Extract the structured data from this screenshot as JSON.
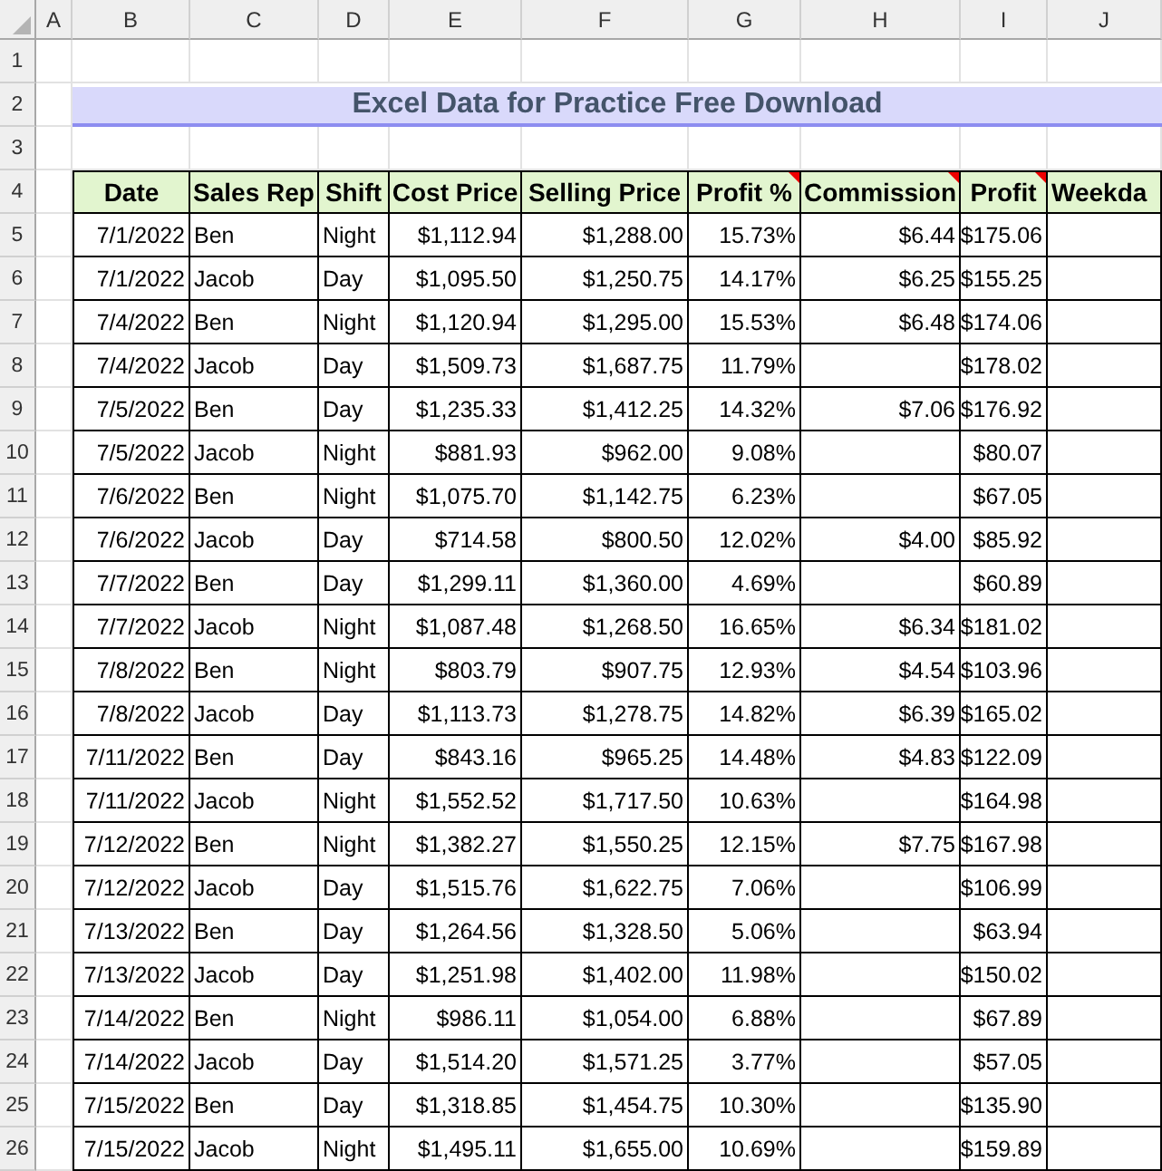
{
  "sheet": {
    "column_letters": [
      "A",
      "B",
      "C",
      "D",
      "E",
      "F",
      "G",
      "H",
      "I",
      "J"
    ],
    "row_numbers": [
      "1",
      "2",
      "3",
      "4",
      "5",
      "6",
      "7",
      "8",
      "9",
      "10",
      "11",
      "12",
      "13",
      "14",
      "15",
      "16",
      "17",
      "18",
      "19",
      "20",
      "21",
      "22",
      "23",
      "24",
      "25",
      "26"
    ],
    "title": "Excel Data for Practice Free Download",
    "columns": [
      {
        "label": "Date",
        "has_comment": false
      },
      {
        "label": "Sales Rep",
        "has_comment": false
      },
      {
        "label": "Shift",
        "has_comment": false
      },
      {
        "label": "Cost Price",
        "has_comment": false
      },
      {
        "label": "Selling Price",
        "has_comment": false
      },
      {
        "label": "Profit %",
        "has_comment": true
      },
      {
        "label": "Commission",
        "has_comment": true
      },
      {
        "label": "Profit",
        "has_comment": true
      },
      {
        "label": "Weekda",
        "has_comment": false
      }
    ],
    "rows": [
      [
        "7/1/2022",
        "Ben",
        "Night",
        "$1,112.94",
        "$1,288.00",
        "15.73%",
        "$6.44",
        "$175.06"
      ],
      [
        "7/1/2022",
        "Jacob",
        "Day",
        "$1,095.50",
        "$1,250.75",
        "14.17%",
        "$6.25",
        "$155.25"
      ],
      [
        "7/4/2022",
        "Ben",
        "Night",
        "$1,120.94",
        "$1,295.00",
        "15.53%",
        "$6.48",
        "$174.06"
      ],
      [
        "7/4/2022",
        "Jacob",
        "Day",
        "$1,509.73",
        "$1,687.75",
        "11.79%",
        null,
        "$178.02"
      ],
      [
        "7/5/2022",
        "Ben",
        "Day",
        "$1,235.33",
        "$1,412.25",
        "14.32%",
        "$7.06",
        "$176.92"
      ],
      [
        "7/5/2022",
        "Jacob",
        "Night",
        "$881.93",
        "$962.00",
        "9.08%",
        null,
        "$80.07"
      ],
      [
        "7/6/2022",
        "Ben",
        "Night",
        "$1,075.70",
        "$1,142.75",
        "6.23%",
        null,
        "$67.05"
      ],
      [
        "7/6/2022",
        "Jacob",
        "Day",
        "$714.58",
        "$800.50",
        "12.02%",
        "$4.00",
        "$85.92"
      ],
      [
        "7/7/2022",
        "Ben",
        "Day",
        "$1,299.11",
        "$1,360.00",
        "4.69%",
        null,
        "$60.89"
      ],
      [
        "7/7/2022",
        "Jacob",
        "Night",
        "$1,087.48",
        "$1,268.50",
        "16.65%",
        "$6.34",
        "$181.02"
      ],
      [
        "7/8/2022",
        "Ben",
        "Night",
        "$803.79",
        "$907.75",
        "12.93%",
        "$4.54",
        "$103.96"
      ],
      [
        "7/8/2022",
        "Jacob",
        "Day",
        "$1,113.73",
        "$1,278.75",
        "14.82%",
        "$6.39",
        "$165.02"
      ],
      [
        "7/11/2022",
        "Ben",
        "Day",
        "$843.16",
        "$965.25",
        "14.48%",
        "$4.83",
        "$122.09"
      ],
      [
        "7/11/2022",
        "Jacob",
        "Night",
        "$1,552.52",
        "$1,717.50",
        "10.63%",
        null,
        "$164.98"
      ],
      [
        "7/12/2022",
        "Ben",
        "Night",
        "$1,382.27",
        "$1,550.25",
        "12.15%",
        "$7.75",
        "$167.98"
      ],
      [
        "7/12/2022",
        "Jacob",
        "Day",
        "$1,515.76",
        "$1,622.75",
        "7.06%",
        null,
        "$106.99"
      ],
      [
        "7/13/2022",
        "Ben",
        "Day",
        "$1,264.56",
        "$1,328.50",
        "5.06%",
        null,
        "$63.94"
      ],
      [
        "7/13/2022",
        "Jacob",
        "Day",
        "$1,251.98",
        "$1,402.00",
        "11.98%",
        null,
        "$150.02"
      ],
      [
        "7/14/2022",
        "Ben",
        "Night",
        "$986.11",
        "$1,054.00",
        "6.88%",
        null,
        "$67.89"
      ],
      [
        "7/14/2022",
        "Jacob",
        "Day",
        "$1,514.20",
        "$1,571.25",
        "3.77%",
        null,
        "$57.05"
      ],
      [
        "7/15/2022",
        "Ben",
        "Day",
        "$1,318.85",
        "$1,454.75",
        "10.30%",
        null,
        "$135.90"
      ],
      [
        "7/15/2022",
        "Jacob",
        "Night",
        "$1,495.11",
        "$1,655.00",
        "10.69%",
        null,
        "$159.89"
      ]
    ]
  }
}
